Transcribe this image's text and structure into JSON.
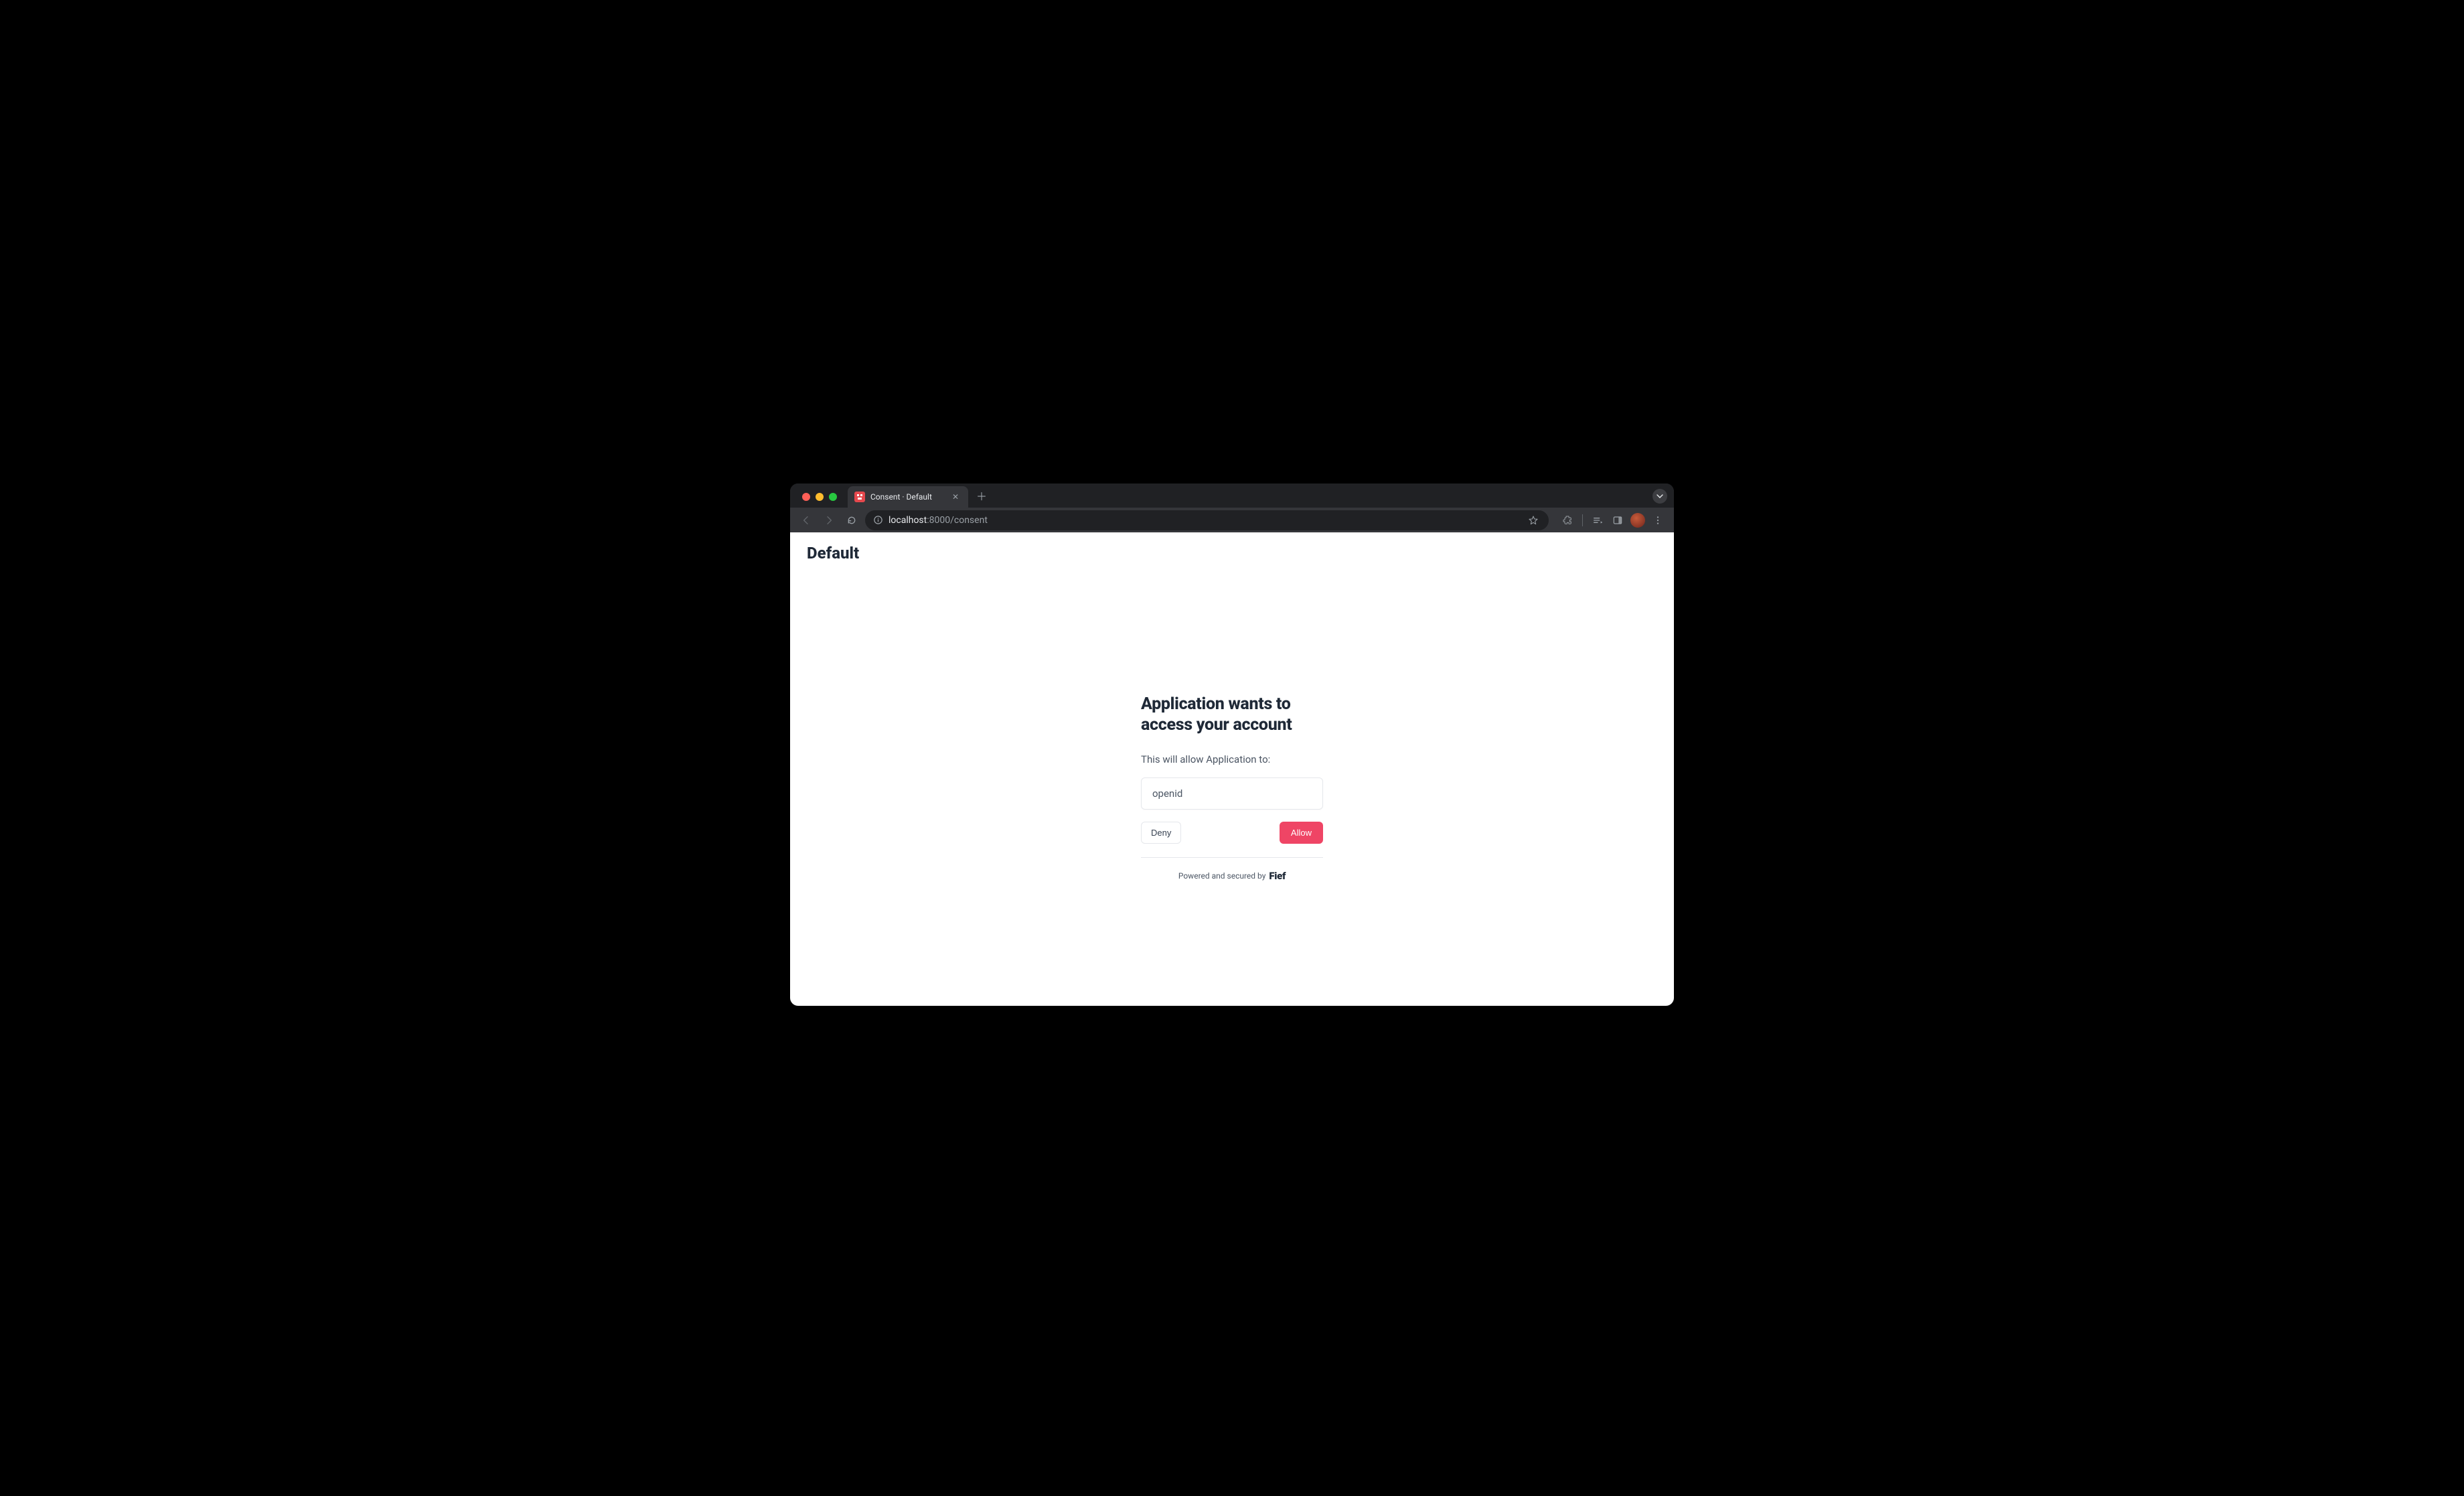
{
  "browser": {
    "tab_title": "Consent · Default",
    "url_host": "localhost",
    "url_port_path": ":8000/consent"
  },
  "page": {
    "tenant_name": "Default",
    "headline": "Application wants to access your account",
    "subtext": "This will allow Application to:",
    "scopes": [
      "openid"
    ],
    "deny_label": "Deny",
    "allow_label": "Allow",
    "powered_text": "Powered and secured by",
    "brand": "Fief"
  },
  "colors": {
    "primary": "#ef4565",
    "text": "#1f2937",
    "muted": "#4b5563",
    "border": "#e5e7eb"
  }
}
